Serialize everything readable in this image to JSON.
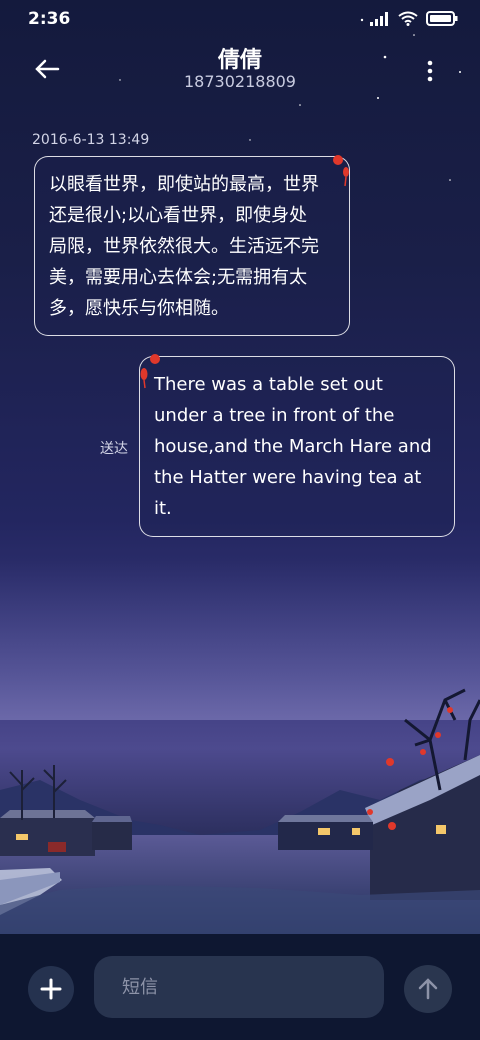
{
  "status_bar": {
    "time": "2:36",
    "icons": [
      "signal-icon",
      "wifi-icon",
      "battery-icon"
    ]
  },
  "header": {
    "title": "倩倩",
    "phone": "18730218809",
    "back_icon": "arrow-left-icon",
    "more_icon": "more-vertical-icon"
  },
  "conversation": {
    "timestamp": "2016-6-13 13:49",
    "messages": [
      {
        "direction": "incoming",
        "lines": [
          "以眼看世界，即使站的最高，世界",
          "还是很小;以心看世界，即使身处",
          "局限，世界依然很大。生活远不完",
          "美，需要用心去体会;无需拥有太",
          "多，愿快乐与你相随。"
        ]
      },
      {
        "direction": "outgoing",
        "lines": [
          "There was a table set out",
          "under a tree in front of the",
          "house,and the March Hare and",
          "the Hatter were having tea at",
          "it."
        ],
        "status": "送达"
      }
    ]
  },
  "composer": {
    "add_icon": "plus-icon",
    "placeholder": "短信",
    "send_icon": "arrow-up-icon"
  },
  "colors": {
    "bottom_bar": "#0e1731",
    "input_bg": "#28344f",
    "lantern": "#e0382b"
  }
}
